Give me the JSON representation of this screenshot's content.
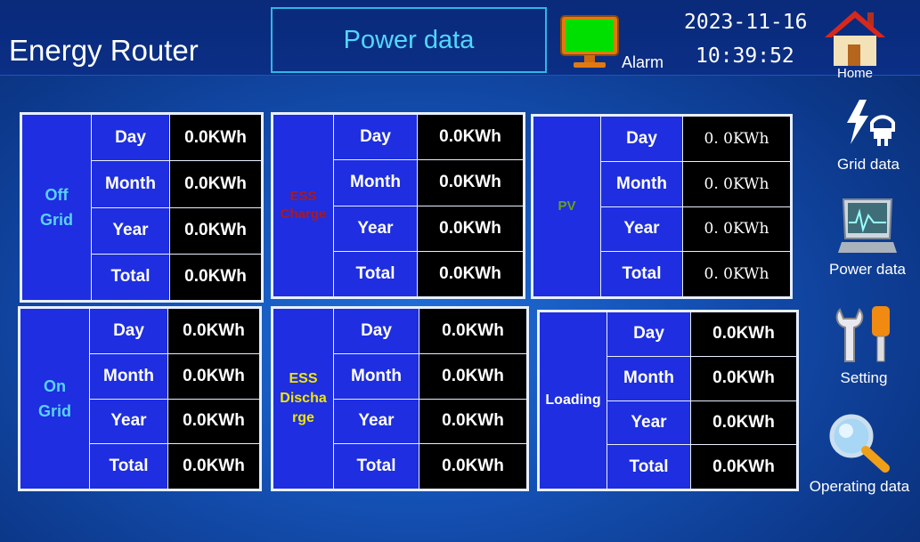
{
  "header": {
    "app_title": "Energy Router",
    "page_title": "Power data",
    "alarm_label": "Alarm",
    "date": "2023-11-16",
    "time": "10:39:52",
    "alarm_color": "#00e000"
  },
  "nav": {
    "home": "Home",
    "grid_data": "Grid data",
    "power_data": "Power data",
    "setting": "Setting",
    "operating_data": "Operating data"
  },
  "row_labels": {
    "day": "Day",
    "month": "Month",
    "year": "Year",
    "total": "Total"
  },
  "panels": {
    "off_grid": {
      "title_1": "Off",
      "title_2": "Grid",
      "color": "#5ad2ff",
      "day": "0.0KWh",
      "month": "0.0KWh",
      "year": "0.0KWh",
      "total": "0.0KWh"
    },
    "on_grid": {
      "title_1": "On",
      "title_2": "Grid",
      "color": "#5ad2ff",
      "day": "0.0KWh",
      "month": "0.0KWh",
      "year": "0.0KWh",
      "total": "0.0KWh"
    },
    "ess_charge": {
      "title_1": "ESS",
      "title_2": "Charge",
      "color": "#b01818",
      "day": "0.0KWh",
      "month": "0.0KWh",
      "year": "0.0KWh",
      "total": "0.0KWh"
    },
    "ess_discharge": {
      "title_1": "ESS",
      "title_2": "Discha",
      "title_3": "rge",
      "color": "#f2e600",
      "day": "0.0KWh",
      "month": "0.0KWh",
      "year": "0.0KWh",
      "total": "0.0KWh"
    },
    "pv": {
      "title_1": "PV",
      "color": "#6aa018",
      "day": "0. 0KWh",
      "month": "0. 0KWh",
      "year": "0. 0KWh",
      "total": "0. 0KWh"
    },
    "loading": {
      "title_1": "Loading",
      "color": "#ffffff",
      "day": "0.0KWh",
      "month": "0.0KWh",
      "year": "0.0KWh",
      "total": "0.0KWh"
    }
  }
}
